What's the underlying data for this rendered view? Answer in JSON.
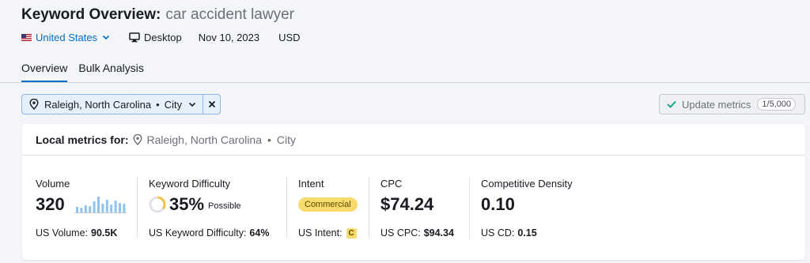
{
  "header": {
    "title_prefix": "Keyword Overview:",
    "keyword": "car accident lawyer",
    "country": "United States",
    "device": "Desktop",
    "date": "Nov 10, 2023",
    "currency": "USD"
  },
  "tabs": [
    {
      "label": "Overview",
      "active": true
    },
    {
      "label": "Bulk Analysis",
      "active": false
    }
  ],
  "location_filter": {
    "place": "Raleigh, North Carolina",
    "separator": "•",
    "type": "City"
  },
  "update": {
    "label": "Update metrics",
    "counter": "1/5,000"
  },
  "local": {
    "label": "Local metrics for:",
    "place": "Raleigh, North Carolina",
    "separator": "•",
    "type": "City"
  },
  "metrics": {
    "volume": {
      "label": "Volume",
      "value": "320",
      "foot_label": "US Volume:",
      "foot_value": "90.5K",
      "trend": [
        0.35,
        0.3,
        0.45,
        0.4,
        0.7,
        1.0,
        0.55,
        0.8,
        0.5,
        0.75,
        0.6,
        0.55
      ]
    },
    "kd": {
      "label": "Keyword Difficulty",
      "value": "35%",
      "qualifier": "Possible",
      "foot_label": "US Keyword Difficulty:",
      "foot_value": "64%",
      "percent": 35
    },
    "intent": {
      "label": "Intent",
      "value": "Commercial",
      "foot_label": "US Intent:",
      "foot_badge": "C"
    },
    "cpc": {
      "label": "CPC",
      "value": "$74.24",
      "foot_label": "US CPC:",
      "foot_value": "$94.34"
    },
    "cd": {
      "label": "Competitive Density",
      "value": "0.10",
      "foot_label": "US CD:",
      "foot_value": "0.15"
    }
  },
  "colors": {
    "accent": "#006dca",
    "intent_commercial": "#f9db6d",
    "kd_ring": "#f5c242",
    "spark": "#8fc4f0"
  }
}
